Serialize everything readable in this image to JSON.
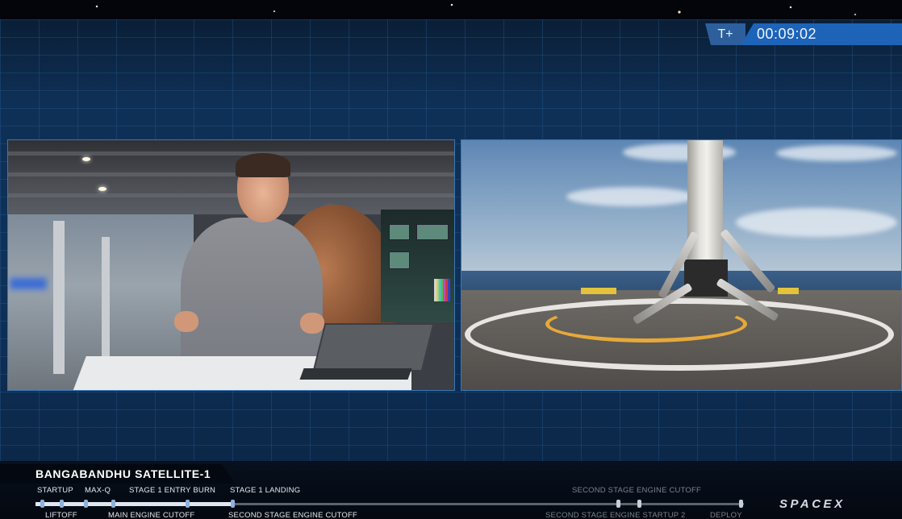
{
  "clock": {
    "prefix": "T+",
    "time": "00:09:02"
  },
  "mission": {
    "name": "BANGABANDHU SATELLITE-1"
  },
  "timeline": {
    "progress": 0.28,
    "top_events": [
      {
        "label": "STARTUP",
        "state": "past"
      },
      {
        "label": "MAX-Q",
        "state": "past"
      },
      {
        "label": "STAGE 1 ENTRY BURN",
        "state": "past"
      },
      {
        "label": "STAGE 1 LANDING",
        "state": "past"
      },
      {
        "label": "SECOND STAGE ENGINE CUTOFF",
        "state": "future"
      }
    ],
    "bottom_events": [
      {
        "label": "LIFTOFF",
        "state": "past"
      },
      {
        "label": "MAIN ENGINE CUTOFF",
        "state": "past"
      },
      {
        "label": "SECOND STAGE ENGINE CUTOFF",
        "state": "past"
      },
      {
        "label": "SECOND STAGE ENGINE STARTUP 2",
        "state": "future"
      },
      {
        "label": "DEPLOY",
        "state": "future"
      }
    ]
  },
  "brand": {
    "logo": "SPACEX"
  },
  "colors": {
    "accent": "#1d64b8",
    "grid": "#0f3158",
    "panel_border": "#3c78b4"
  },
  "feeds": {
    "left": "host-studio-feed",
    "right": "droneship-landing-feed"
  }
}
